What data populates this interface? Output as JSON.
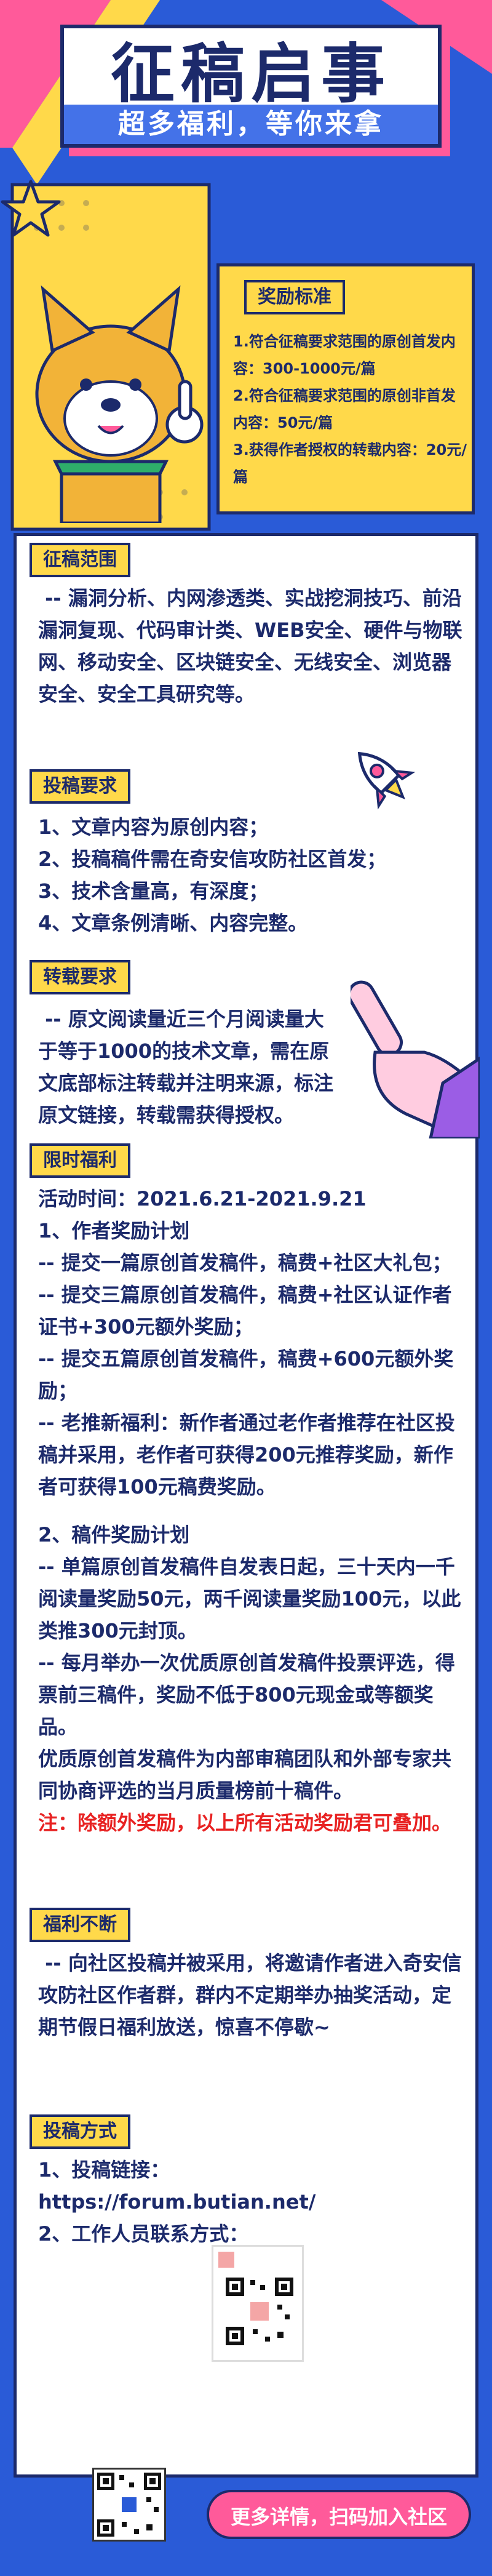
{
  "header": {
    "title": "征稿启事",
    "subtitle": "超多福利，等你来拿"
  },
  "rewards": {
    "tag": "奖励标准",
    "text": "1.符合征稿要求范围的原创首发内容：300-1000元/篇\n2.符合征稿要求范围的原创非首发内容：50元/篇\n3.获得作者授权的转载内容：20元/篇"
  },
  "scope": {
    "tag": "征稿范围",
    "text": " -- 漏洞分析、内网渗透类、实战挖洞技巧、前沿漏洞复现、代码审计类、WEB安全、硬件与物联网、移动安全、区块链安全、无线安全、浏览器安全、安全工具研究等。"
  },
  "requirements": {
    "tag": "投稿要求",
    "items": [
      "1、文章内容为原创内容；",
      "2、投稿稿件需在奇安信攻防社区首发；",
      "3、技术含量高，有深度；",
      "4、文章条例清晰、内容完整。"
    ]
  },
  "repost": {
    "tag": "转载要求",
    "text": " -- 原文阅读量近三个月阅读量大于等于1000的技术文章，需在原文底部标注转载并注明来源，标注原文链接，转载需获得授权。"
  },
  "limited": {
    "tag": "限时福利",
    "period": "活动时间：2021.6.21-2021.9.21",
    "plan1_title": "1、作者奖励计划",
    "plan1_items": [
      "-- 提交一篇原创首发稿件，稿费+社区大礼包；",
      "-- 提交三篇原创首发稿件，稿费+社区认证作者证书+300元额外奖励；",
      "-- 提交五篇原创首发稿件，稿费+600元额外奖励；",
      "-- 老推新福利：新作者通过老作者推荐在社区投稿并采用，老作者可获得200元推荐奖励，新作者可获得100元稿费奖励。"
    ],
    "plan2_title": "2、稿件奖励计划",
    "plan2_items": [
      "-- 单篇原创首发稿件自发表日起，三十天内一千阅读量奖励50元，两千阅读量奖励100元，以此类推300元封顶。",
      "-- 每月举办一次优质原创首发稿件投票评选，得票前三稿件，奖励不低于800元现金或等额奖品。",
      "优质原创首发稿件为内部审稿团队和外部专家共同协商评选的当月质量榜前十稿件。"
    ],
    "note": "注：除额外奖励，以上所有活动奖励君可叠加。"
  },
  "ongoing": {
    "tag": "福利不断",
    "text": " -- 向社区投稿并被采用，将邀请作者进入奇安信攻防社区作者群，群内不定期举办抽奖活动，定期节假日福利放送，惊喜不停歇~"
  },
  "submit": {
    "tag": "投稿方式",
    "link_label": "1、投稿链接：",
    "link": "https://forum.butian.net/",
    "contact_label": "2、工作人员联系方式："
  },
  "cta": {
    "label": "更多详情，扫码加入社区"
  },
  "colors": {
    "background": "#2a5bd7",
    "navy": "#1c2a6b",
    "yellow": "#ffd94a",
    "pink": "#ff5a9a",
    "red": "#e82222"
  }
}
